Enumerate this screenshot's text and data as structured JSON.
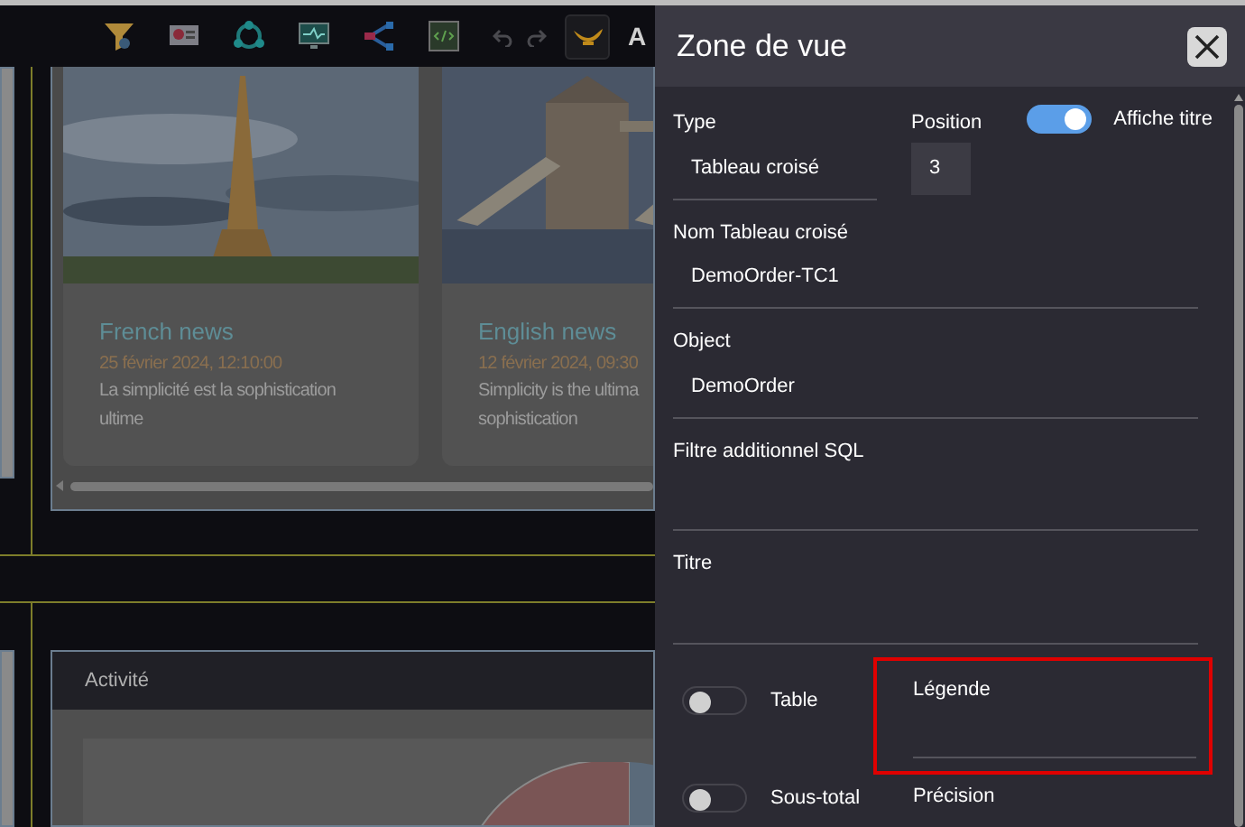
{
  "toolbar": {
    "cut_label": "A"
  },
  "news": [
    {
      "title": "French news",
      "date": "25 février 2024, 12:10:00",
      "lines": [
        "La simplicité est la sophistication",
        "ultime"
      ]
    },
    {
      "title": "English news",
      "date": "12 février 2024, 09:30",
      "lines": [
        "Simplicity is the ultima",
        "sophistication"
      ]
    }
  ],
  "activity": {
    "title": "Activité"
  },
  "panel": {
    "title": "Zone de vue",
    "type": {
      "label": "Type",
      "value": "Tableau croisé"
    },
    "position": {
      "label": "Position",
      "value": "3"
    },
    "show_title": {
      "label": "Affiche titre",
      "on": true
    },
    "name": {
      "label": "Nom Tableau croisé",
      "value": "DemoOrder-TC1"
    },
    "object": {
      "label": "Object",
      "value": "DemoOrder"
    },
    "sql_filter": {
      "label": "Filtre additionnel SQL"
    },
    "title_field": {
      "label": "Titre"
    },
    "table": {
      "label": "Table",
      "on": false
    },
    "legend": {
      "label": "Légende",
      "highlighted": true
    },
    "subtotal": {
      "label": "Sous-total",
      "on": false
    },
    "precision": {
      "label": "Précision"
    }
  }
}
